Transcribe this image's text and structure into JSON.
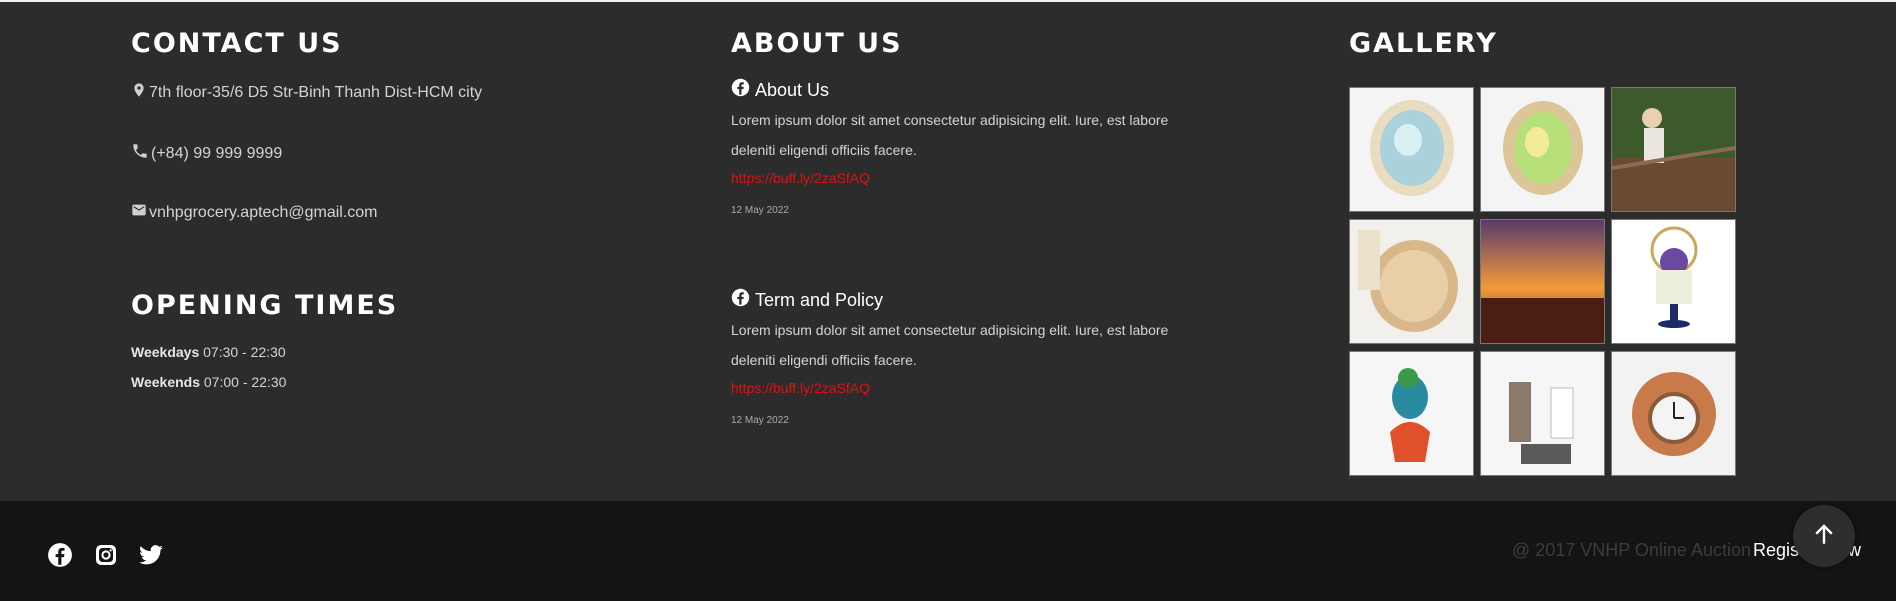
{
  "contact": {
    "title": "CONTACT US",
    "address": "7th floor-35/6 D5 Str-Binh Thanh Dist-HCM city",
    "phone": "(+84) 99 999 9999",
    "email": "vnhpgrocery.aptech@gmail.com",
    "icons": [
      "map-pin-icon",
      "phone-icon",
      "mail-icon"
    ]
  },
  "opening": {
    "title": "OPENING TIMES",
    "rows": [
      {
        "label": "Weekdays",
        "time": "07:30 - 22:30"
      },
      {
        "label": "Weekends",
        "time": "07:00 - 22:30"
      }
    ]
  },
  "about": {
    "title": "ABOUT US",
    "posts": [
      {
        "icon": "facebook-icon",
        "title": "About Us",
        "body": "Lorem ipsum dolor sit amet consectetur adipisicing elit. Iure, est labore deleniti eligendi officiis facere.",
        "link": "https://buff.ly/2zaSfAQ",
        "date": "12 May 2022"
      },
      {
        "icon": "facebook-icon",
        "title": "Term and Policy",
        "body": "Lorem ipsum dolor sit amet consectetur adipisicing elit. Iure, est labore deleniti eligendi officiis facere.",
        "link": "https://buff.ly/2zaSfAQ",
        "date": "12 May 2022"
      }
    ]
  },
  "gallery": {
    "title": "GALLERY",
    "items": [
      "aquamarine-ring",
      "opal-ring",
      "woman-on-bridge",
      "morganite-ring",
      "sunset-field",
      "flower-basket-egg",
      "bird-figurine",
      "musician-figurines",
      "diving-helmet-clock"
    ]
  },
  "footer": {
    "social_icons": [
      "facebook-icon",
      "instagram-icon",
      "twitter-icon"
    ],
    "copyright": "@ 2017 VNHP Online Auction",
    "register": "Register Now",
    "to_top_icon": "arrow-up-icon"
  },
  "colors": {
    "background": "#2c2c2c",
    "bottom_bar": "#141414",
    "link": "#e01010",
    "heading": "#ffffff"
  }
}
